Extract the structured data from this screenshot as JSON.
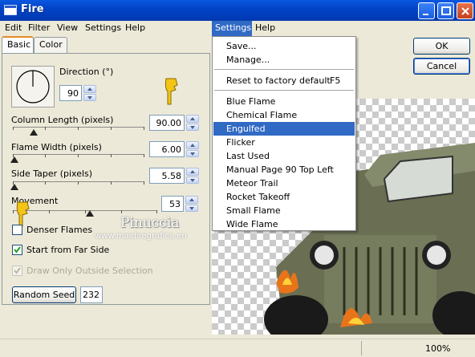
{
  "window": {
    "title": "Fire"
  },
  "menubar": {
    "items": [
      "Edit",
      "Filter",
      "View",
      "Settings",
      "Help"
    ],
    "right_items": [
      "Settings",
      "Help"
    ]
  },
  "tabs": {
    "basic": "Basic",
    "color": "Color"
  },
  "controls": {
    "direction": {
      "label": "Direction (°)",
      "value": "90"
    },
    "column_length": {
      "label": "Column Length (pixels)",
      "value": "90.00"
    },
    "flame_width": {
      "label": "Flame Width (pixels)",
      "value": "6.00"
    },
    "side_taper": {
      "label": "Side Taper (pixels)",
      "value": "5.58"
    },
    "movement": {
      "label": "Movement",
      "value": "53"
    },
    "denser_flames": {
      "label": "Denser Flames",
      "checked": false
    },
    "start_far_side": {
      "label": "Start from Far Side",
      "checked": true
    },
    "draw_only_outside": {
      "label": "Draw Only Outside Selection",
      "checked": true,
      "disabled": true
    },
    "random_seed": {
      "label": "Random Seed",
      "value": "232"
    }
  },
  "buttons": {
    "ok": "OK",
    "cancel": "Cancel"
  },
  "settings_menu": {
    "items": [
      {
        "label": "Save..."
      },
      {
        "label": "Manage..."
      },
      {
        "label": "Reset to factory default",
        "shortcut": "F5"
      },
      {
        "label": "Blue Flame"
      },
      {
        "label": "Chemical Flame"
      },
      {
        "label": "Engulfed",
        "highlighted": true
      },
      {
        "label": "Flicker"
      },
      {
        "label": "Last Used"
      },
      {
        "label": "Manual Page 90 Top Left"
      },
      {
        "label": "Meteor Trail"
      },
      {
        "label": "Rocket Takeoff"
      },
      {
        "label": "Small Flame"
      },
      {
        "label": "Wide Flame"
      }
    ]
  },
  "watermark": {
    "line1": "Pinuccia",
    "line2": "www.maidiregrafica.eu"
  },
  "status": {
    "zoom": "100%"
  },
  "colors": {
    "titlebar": "#0a58e0",
    "menu_highlight": "#316ac5",
    "dialog_bg": "#ece9d8"
  }
}
